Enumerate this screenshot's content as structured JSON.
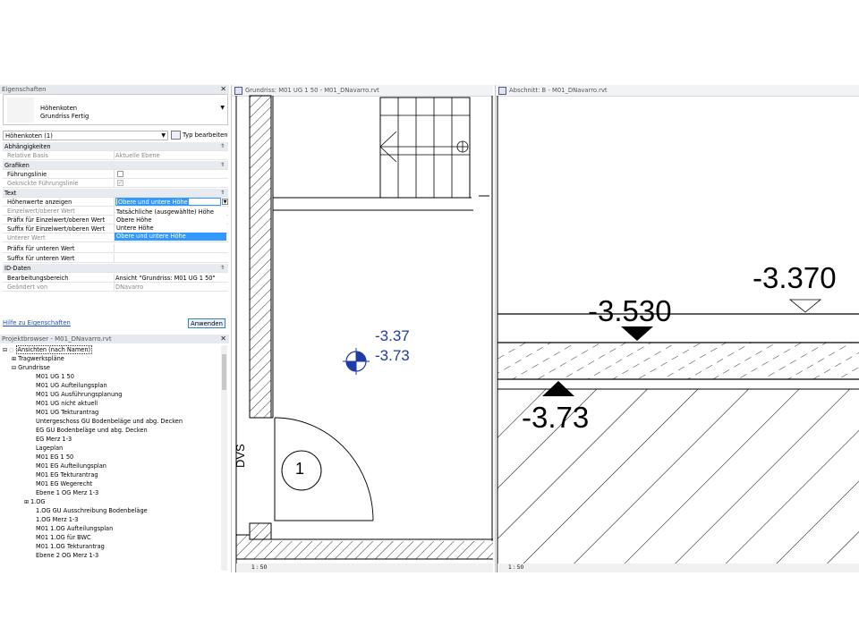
{
  "properties": {
    "title": "Eigenschaften",
    "type_name": "Höhenkoten",
    "type_sub": "Grundriss Fertig",
    "selector_value": "Höhenkoten (1)",
    "edit_type_label": "Typ bearbeiten",
    "groups": {
      "dependencies": "Abhängigkeiten",
      "graphics": "Grafiken",
      "text": "Text",
      "id": "ID-Daten"
    },
    "rows": {
      "relative_base": {
        "key": "Relative Basis",
        "value": "Aktuelle Ebene"
      },
      "leader": {
        "key": "Führungslinie",
        "value": ""
      },
      "bent_leader": {
        "key": "Geknickte Führungslinie",
        "value": ""
      },
      "show_values": {
        "key": "Höhenwerte anzeigen",
        "value": "Obere und untere Höhe"
      },
      "single_upper": {
        "key": "Einzelwert/oberer Wert",
        "value": ""
      },
      "prefix_single": {
        "key": "Präfix für Einzelwert/oberen Wert",
        "value": ""
      },
      "suffix_single": {
        "key": "Suffix für Einzelwert/oberen Wert",
        "value": ""
      },
      "lower": {
        "key": "Unterer Wert",
        "value": ""
      },
      "prefix_lower": {
        "key": "Präfix für unteren Wert",
        "value": ""
      },
      "suffix_lower": {
        "key": "Suffix für unteren Wert",
        "value": ""
      },
      "work_area": {
        "key": "Bearbeitungsbereich",
        "value": "Ansicht \"Grundriss: M01 UG 1 50\""
      },
      "changed_by": {
        "key": "Geändert von",
        "value": "DNavarro"
      }
    },
    "dropdown_options": [
      "Tatsächliche (ausgewählte) Höhe",
      "Obere Höhe",
      "Untere Höhe",
      "Obere und untere Höhe"
    ],
    "help_link": "Hilfe zu Eigenschaften",
    "apply_button": "Anwenden"
  },
  "browser": {
    "title": "Projektbrowser - M01_DNavarro.rvt",
    "root": "Ansichten (nach Namen)",
    "folder_structural": "Tragwerkspläne",
    "folder_floorplans": "Grundrisse",
    "items": [
      "M01 UG 1 50",
      "M01 UG Aufteilungsplan",
      "M01 UG Ausführungsplanung",
      "M01 UG nicht aktuell",
      "M01 UG Tekturantrag",
      "Untergeschoss GU Bodenbeläge und abg. Decken",
      "EG GU Bodenbeläge und abg. Decken",
      "EG Merz 1-3",
      "Lageplan",
      "M01 EG 1 50",
      "M01 EG Aufteilungsplan",
      "M01 EG Tekturantrag",
      "M01 EG Wegerecht",
      "Ebene 1 OG Merz 1-3",
      "1.OG",
      "1.OG GU Ausschreibung Bodenbeläge",
      "1.OG Merz 1-3",
      "M01 1.OG Aufteilungsplan",
      "M01 1.OG für BWC",
      "M01 1.OG Tekturantrag",
      "Ebene 2 OG Merz 1-3"
    ]
  },
  "plan_view": {
    "tab_title": "Grundriss: M01 UG 1 50 - M01_DNavarro.rvt",
    "spot_upper": "-3.37",
    "spot_lower": "-3.73",
    "room_tag": "1",
    "wall_tag": "DVS",
    "scale": "1 : 50",
    "accent_color": "#1f3ba8"
  },
  "section_view": {
    "tab_title": "Abschnitt: B - M01_DNavarro.rvt",
    "elev_top": "-3.370",
    "elev_mid": "-3.530",
    "elev_low": "-3.73",
    "scale": "1 : 50"
  }
}
